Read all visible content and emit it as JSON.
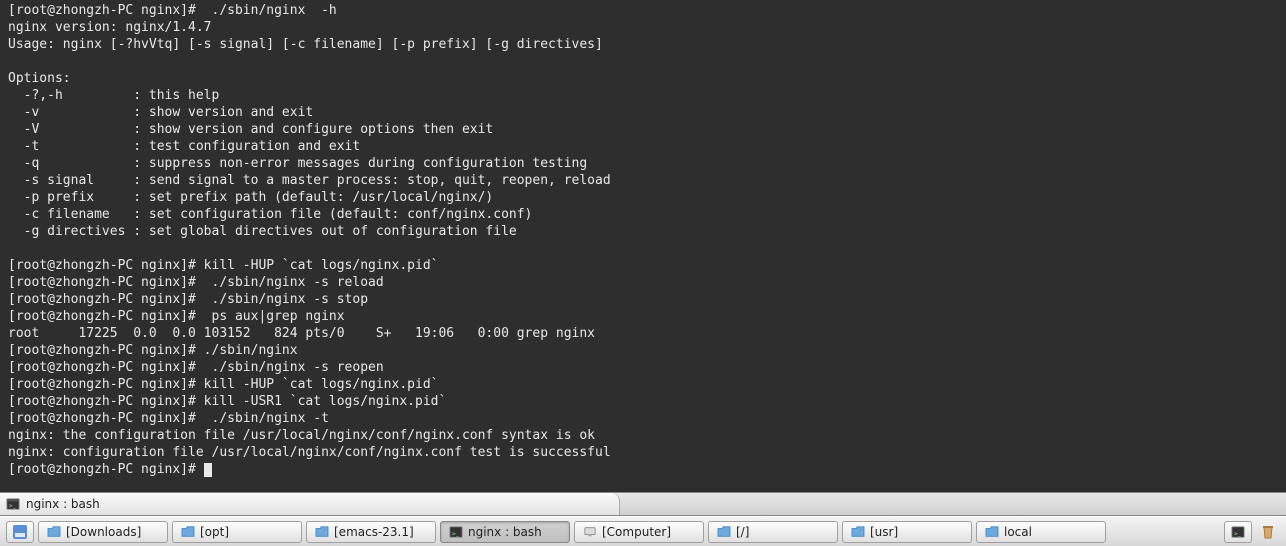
{
  "terminal": {
    "lines": [
      "[root@zhongzh-PC nginx]#  ./sbin/nginx  -h",
      "nginx version: nginx/1.4.7",
      "Usage: nginx [-?hvVtq] [-s signal] [-c filename] [-p prefix] [-g directives]",
      "",
      "Options:",
      "  -?,-h         : this help",
      "  -v            : show version and exit",
      "  -V            : show version and configure options then exit",
      "  -t            : test configuration and exit",
      "  -q            : suppress non-error messages during configuration testing",
      "  -s signal     : send signal to a master process: stop, quit, reopen, reload",
      "  -p prefix     : set prefix path (default: /usr/local/nginx/)",
      "  -c filename   : set configuration file (default: conf/nginx.conf)",
      "  -g directives : set global directives out of configuration file",
      "",
      "[root@zhongzh-PC nginx]# kill -HUP `cat logs/nginx.pid`",
      "[root@zhongzh-PC nginx]#  ./sbin/nginx -s reload",
      "[root@zhongzh-PC nginx]#  ./sbin/nginx -s stop",
      "[root@zhongzh-PC nginx]#  ps aux|grep nginx",
      "root     17225  0.0  0.0 103152   824 pts/0    S+   19:06   0:00 grep nginx",
      "[root@zhongzh-PC nginx]# ./sbin/nginx",
      "[root@zhongzh-PC nginx]#  ./sbin/nginx -s reopen",
      "[root@zhongzh-PC nginx]# kill -HUP `cat logs/nginx.pid`",
      "[root@zhongzh-PC nginx]# kill -USR1 `cat logs/nginx.pid`",
      "[root@zhongzh-PC nginx]#  ./sbin/nginx -t",
      "nginx: the configuration file /usr/local/nginx/conf/nginx.conf syntax is ok",
      "nginx: configuration file /usr/local/nginx/conf/nginx.conf test is successful"
    ],
    "prompt": "[root@zhongzh-PC nginx]# "
  },
  "tab": {
    "title": "nginx : bash"
  },
  "taskbar": {
    "items": [
      {
        "label": "[Downloads]",
        "type": "folder",
        "active": false
      },
      {
        "label": "[opt]",
        "type": "folder",
        "active": false
      },
      {
        "label": "[emacs-23.1]",
        "type": "folder",
        "active": false
      },
      {
        "label": "nginx : bash",
        "type": "terminal",
        "active": true
      },
      {
        "label": "[Computer]",
        "type": "folder",
        "active": false
      },
      {
        "label": "[/]",
        "type": "folder",
        "active": false
      },
      {
        "label": "[usr]",
        "type": "folder",
        "active": false
      },
      {
        "label": "local",
        "type": "folder",
        "active": false
      }
    ]
  }
}
